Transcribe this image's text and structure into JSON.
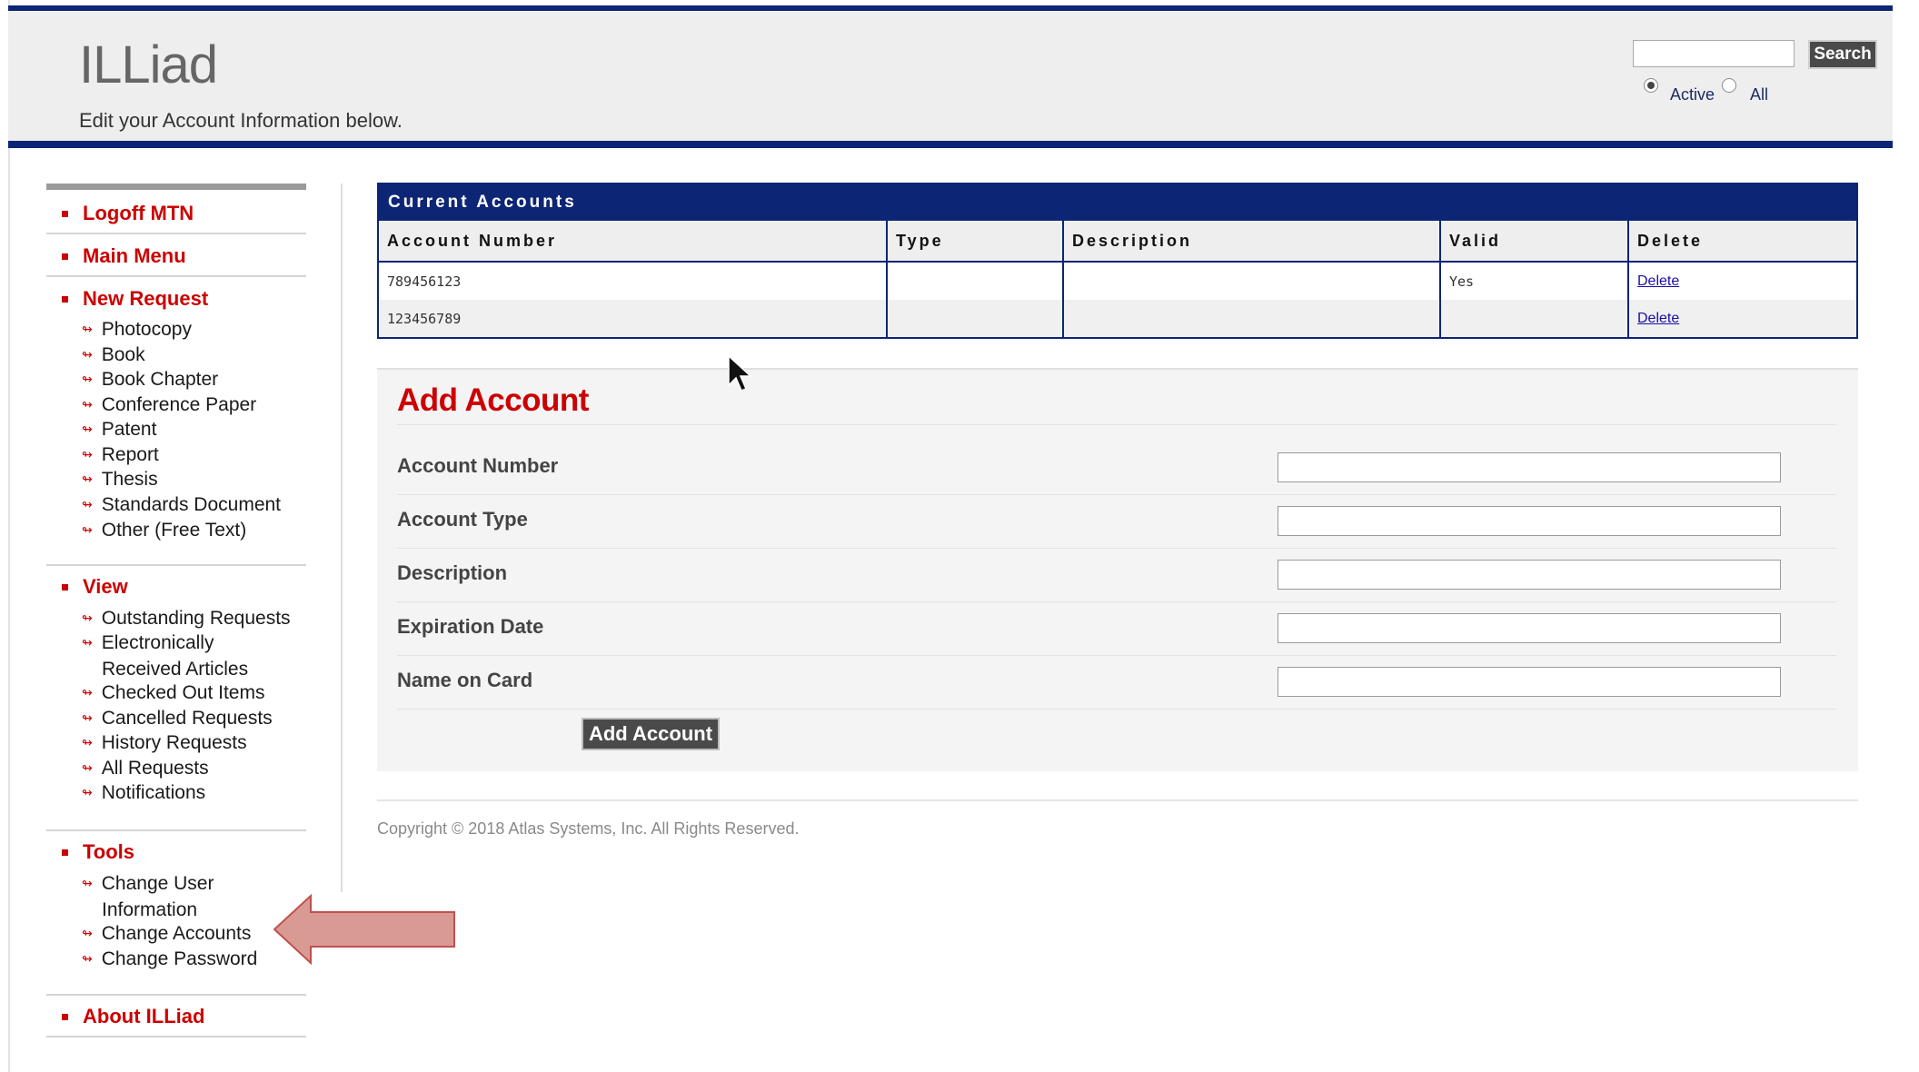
{
  "header": {
    "app_title": "ILLiad",
    "subtitle": "Edit your Account Information below.",
    "search": {
      "input_value": "",
      "button_label": "Search",
      "radio_active_label": "Active",
      "radio_all_label": "All",
      "selected": "Active"
    }
  },
  "sidebar": {
    "logoff": "Logoff MTN",
    "main_menu": "Main Menu",
    "new_request": {
      "label": "New Request",
      "items": [
        "Photocopy",
        "Book",
        "Book Chapter",
        "Conference Paper",
        "Patent",
        "Report",
        "Thesis",
        "Standards Document",
        "Other (Free Text)"
      ]
    },
    "view": {
      "label": "View",
      "items": [
        {
          "line1": "Outstanding Requests"
        },
        {
          "line1": "Electronically",
          "line2": "Received Articles"
        },
        {
          "line1": "Checked Out Items"
        },
        {
          "line1": "Cancelled Requests"
        },
        {
          "line1": "History Requests"
        },
        {
          "line1": "All Requests"
        },
        {
          "line1": "Notifications"
        }
      ]
    },
    "tools": {
      "label": "Tools",
      "items": [
        {
          "line1": "Change User",
          "line2": "Information"
        },
        {
          "line1": "Change Accounts"
        },
        {
          "line1": "Change Password"
        }
      ]
    },
    "about": "About ILLiad"
  },
  "accounts_table": {
    "caption": "Current Accounts",
    "columns": [
      "Account Number",
      "Type",
      "Description",
      "Valid",
      "Delete"
    ],
    "rows": [
      {
        "account_number": "789456123",
        "type": "",
        "description": "",
        "valid": "Yes",
        "delete": "Delete"
      },
      {
        "account_number": "123456789",
        "type": "",
        "description": "",
        "valid": "",
        "delete": "Delete"
      }
    ]
  },
  "add_account": {
    "title": "Add Account",
    "fields": [
      {
        "label": "Account Number",
        "value": ""
      },
      {
        "label": "Account Type",
        "value": ""
      },
      {
        "label": "Description",
        "value": ""
      },
      {
        "label": "Expiration Date",
        "value": ""
      },
      {
        "label": "Name on Card",
        "value": ""
      }
    ],
    "submit_label": "Add Account"
  },
  "footer": {
    "copyright": "Copyright © 2018 Atlas Systems, Inc. All Rights Reserved."
  },
  "colors": {
    "navy": "#0d2575",
    "red": "#cc0000",
    "callout_fill": "#d99a94",
    "callout_stroke": "#c0504d"
  },
  "icons": [
    "radio-selected-icon",
    "radio-icon",
    "square-bullet-icon",
    "small-arrow-icon",
    "callout-arrow-icon",
    "mouse-pointer-icon"
  ]
}
